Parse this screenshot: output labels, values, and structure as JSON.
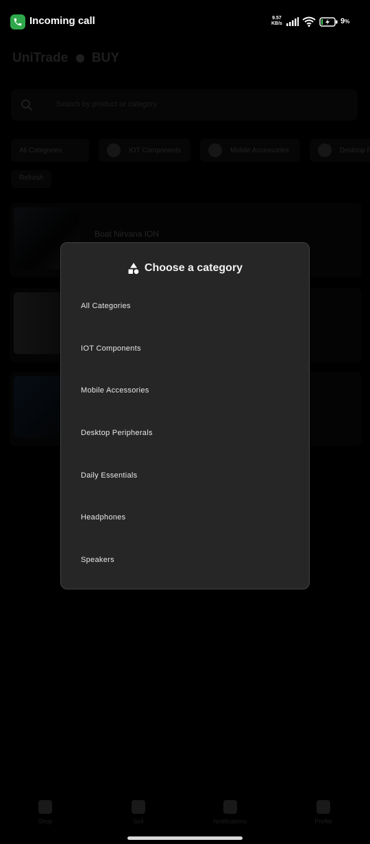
{
  "status_bar": {
    "call_label": "Incoming call",
    "net_speed_value": "9.57",
    "net_speed_unit": "KB/s",
    "battery_pct": "9",
    "battery_suffix": "%"
  },
  "background_app": {
    "title": "UniTrade",
    "mode": "BUY",
    "search_placeholder": "Search by product or category",
    "filter_chips": [
      "All Categories",
      "IOT Components",
      "Mobile Accessories",
      "Desktop Peripherals"
    ],
    "secondary_chip": "Refresh",
    "listing_name": "Boat Nirvana ION",
    "nav_items": [
      "Shop",
      "Sell",
      "Notifications",
      "Profile"
    ]
  },
  "dialog": {
    "icon": "category-shapes-icon",
    "title": "Choose a category",
    "categories": [
      "All Categories",
      "IOT Components",
      "Mobile Accessories",
      "Desktop Peripherals",
      "Daily Essentials",
      "Headphones",
      "Speakers"
    ]
  },
  "colors": {
    "dialog_bg": "#262626",
    "call_green": "#2ea84a",
    "page_bg": "#000000"
  }
}
